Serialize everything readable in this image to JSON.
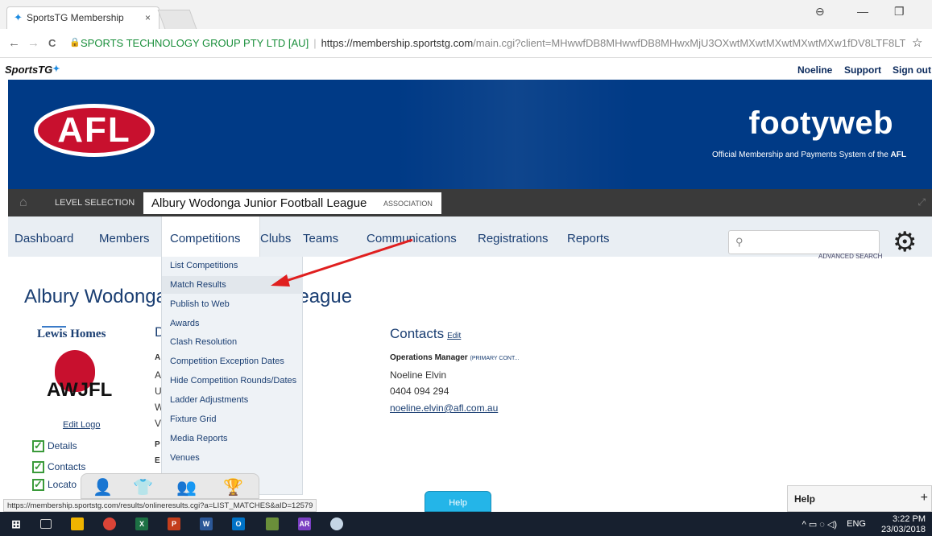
{
  "browser": {
    "tab_title": "SportsTG Membership",
    "tab_close": "×",
    "back": "←",
    "forward": "→",
    "reload": "C",
    "cert": "SPORTS TECHNOLOGY GROUP PTY LTD [AU]",
    "url_host": "https://membership.sportstg.com",
    "url_path": "/main.cgi?client=MHwwfDB8MHwwfDB8MHwxMjU3OXwtMXwtMXwtMXwtMXw1fDV8LTF8LTF...",
    "star": "☆",
    "win_account": "⊖",
    "win_min": "—",
    "win_restore": "❐"
  },
  "site": {
    "brand": "SportsTG",
    "brand_star": "✦",
    "links": [
      "Noeline",
      "Support",
      "Sign out"
    ]
  },
  "hero": {
    "afl_logo": "AFL",
    "footyweb": "footyweb",
    "tagline_pre": "Official Membership and Payments System of the ",
    "tagline_bold": "AFL"
  },
  "levelbar": {
    "home_icon": "home-icon",
    "level_selection": "LEVEL SELECTION",
    "org": "Albury Wodonga Junior Football League",
    "org_type": "ASSOCIATION"
  },
  "nav": {
    "items": [
      "Dashboard",
      "Members",
      "Competitions",
      "Clubs",
      "Teams",
      "Communications",
      "Registrations",
      "Reports"
    ],
    "advanced_search": "ADVANCED SEARCH",
    "gear": "⚙",
    "search_icon": "⚲"
  },
  "dropdown": {
    "items": [
      "List Competitions",
      "Match Results",
      "Publish to Web",
      "Awards",
      "Clash Resolution",
      "Competition Exception Dates",
      "Hide Competition Rounds/Dates",
      "Ladder Adjustments",
      "Fixture Grid",
      "Media Reports",
      "Venues"
    ],
    "highlighted_index": 1
  },
  "content": {
    "title_left": "Albury Wodonga",
    "title_right": "League",
    "sponsor": "Lewis Homes",
    "club_logo_text": "AWJFL",
    "edit_logo": "Edit Logo",
    "checks": [
      "Details",
      "Contacts",
      "Locato"
    ],
    "fragments": [
      "D",
      "A",
      "A",
      "U",
      "W",
      "V",
      "P",
      "E"
    ],
    "contacts_heading": "Contacts",
    "contacts_edit": "Edit",
    "ops_manager": "Operations Manager",
    "primary_contact": "(PRIMARY CONT...",
    "contact_name": "Noeline Elvin",
    "contact_phone": "0404 094 294",
    "contact_email": "noeline.elvin@afl.com.au"
  },
  "status": {
    "hover_url": "https://membership.sportstg.com/results/onlineresults.cgi?a=LIST_MATCHES&aID=12579",
    "help_tab": "Help",
    "help_panel": "Help",
    "help_plus": "+"
  },
  "taskbar": {
    "lang": "ENG",
    "time": "3:22 PM",
    "date": "23/03/2018",
    "tray_icons": "^ ▭ ◌ ◁)"
  },
  "colors": {
    "hero_blue": "#003a86",
    "nav_text": "#1a3e72",
    "annotation_arrow": "#e01f1f"
  }
}
